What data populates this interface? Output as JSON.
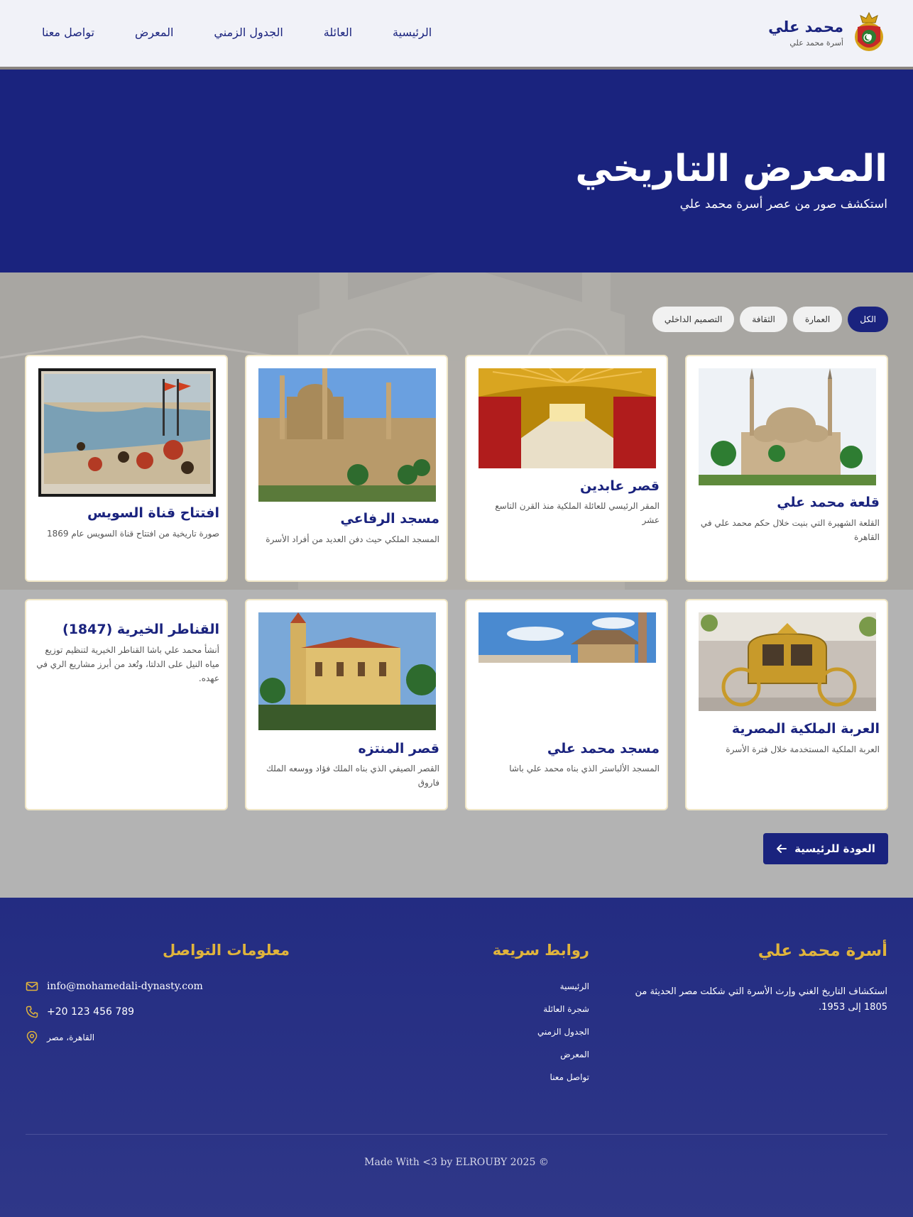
{
  "header": {
    "brand_name": "محمد علي",
    "brand_sub": "أسرة محمد علي",
    "nav": [
      "الرئيسية",
      "العائلة",
      "الجدول الزمني",
      "المعرض",
      "تواصل معنا"
    ]
  },
  "hero": {
    "title": "المعرض التاريخي",
    "subtitle": "استكشف صور من عصر أسرة محمد علي"
  },
  "filters": [
    {
      "label": "الكل",
      "active": true
    },
    {
      "label": "العمارة",
      "active": false
    },
    {
      "label": "الثقافة",
      "active": false
    },
    {
      "label": "التصميم الداخلي",
      "active": false
    }
  ],
  "cards": [
    {
      "title": "قلعة محمد علي",
      "desc": "القلعة الشهيرة التي بنيت خلال حكم محمد علي في القاهرة",
      "image": "mosque-citadel"
    },
    {
      "title": "قصر عابدين",
      "desc": "المقر الرئيسي للعائلة الملكية منذ القرن التاسع عشر",
      "image": "palace-hall"
    },
    {
      "title": "مسجد الرفاعي",
      "desc": "المسجد الملكي حيث دفن العديد من أفراد الأسرة",
      "image": "rifai-mosque"
    },
    {
      "title": "افتتاح قناة السويس",
      "desc": "صورة تاريخية من افتتاح قناة السويس عام 1869",
      "image": "suez-painting"
    },
    {
      "title": "العربة الملكية المصرية",
      "desc": "العربة الملكية المستخدمة خلال فترة الأسرة",
      "image": "royal-carriage"
    },
    {
      "title": "مسجد محمد علي",
      "desc": "المسجد الألباستر الذي بناه محمد علي باشا",
      "image": "mosque-sky"
    },
    {
      "title": "قصر المنتزه",
      "desc": "القصر الصيفي الذي بناه الملك فؤاد ووسعه الملك فاروق",
      "image": "montaza-palace"
    },
    {
      "title": "القناطر الخيرية (1847)",
      "desc": "أنشأ محمد علي باشا القناطر الخيرية لتنظيم توزيع مياه النيل على الدلتا، وتُعد من أبرز مشاريع الري في عهده.",
      "image": ""
    }
  ],
  "back_button": "العودة للرئيسية",
  "footer": {
    "about_title": "أسرة محمد علي",
    "about_text": "استكشاف التاريخ الغني وإرث الأسرة التي شكلت مصر الحديثة من 1805 إلى 1953.",
    "links_title": "روابط سريعة",
    "links": [
      "الرئيسية",
      "شجرة العائلة",
      "الجدول الزمني",
      "المعرض",
      "تواصل معنا"
    ],
    "contact_title": "معلومات التواصل",
    "email": "info@mohamedali-dynasty.com",
    "phone": "+20 123 456 789",
    "location": "القاهرة، مصر",
    "copyright": "Made With <3 by ELROUBY 2025 ©"
  },
  "colors": {
    "primary": "#1a237e",
    "gold": "#e0b43c"
  }
}
